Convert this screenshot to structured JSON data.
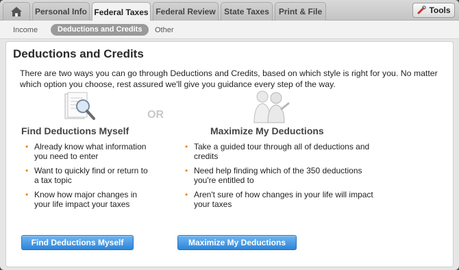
{
  "tabs": [
    {
      "label": "Personal Info"
    },
    {
      "label": "Federal Taxes"
    },
    {
      "label": "Federal Review"
    },
    {
      "label": "State Taxes"
    },
    {
      "label": "Print & File"
    }
  ],
  "tools_label": "Tools",
  "subnav": [
    {
      "label": "Income"
    },
    {
      "label": "Deductions and Credits"
    },
    {
      "label": "Other"
    }
  ],
  "page_title": "Deductions and Credits",
  "intro": "There are two ways you can go through Deductions and Credits, based on which style is right for you. No matter which option you choose, rest assured we'll give you guidance every step of the way.",
  "or_label": "OR",
  "left": {
    "title": "Find Deductions Myself",
    "bullets": [
      "Already know what information you need to enter",
      "Want to quickly find or return to a tax topic",
      "Know how major changes in your life impact your taxes"
    ],
    "button": "Find Deductions Myself"
  },
  "right": {
    "title": "Maximize My Deductions",
    "bullets": [
      "Take a guided tour through all of deductions and credits",
      "Need help finding which of the 350 deductions you're entitled to",
      "Aren't sure of how changes in your life will impact your taxes"
    ],
    "button": "Maximize My Deductions"
  },
  "colors": {
    "accent_blue": "#2d85d8",
    "bullet_orange": "#e8851c"
  }
}
